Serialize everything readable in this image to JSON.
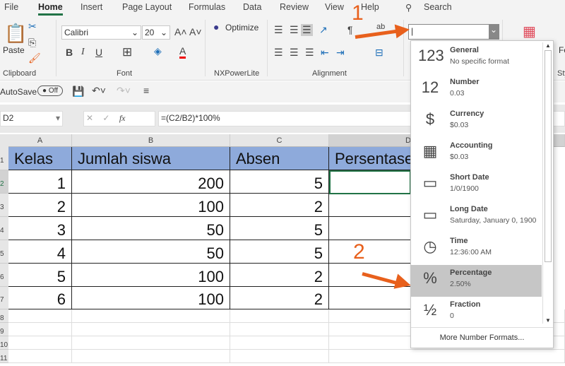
{
  "menu": [
    "File",
    "Home",
    "Insert",
    "Page Layout",
    "Formulas",
    "Data",
    "Review",
    "View",
    "Help"
  ],
  "search": "Search",
  "ribbon": {
    "paste": "Paste",
    "font_name": "Calibri",
    "font_size": "20",
    "optimize": "Optimize",
    "groups": {
      "clipboard": "Clipboard",
      "font": "Font",
      "nx": "NXPowerLite",
      "alignment": "Alignment",
      "styles": "Sty"
    },
    "fo": "Fo",
    "bold": "B",
    "italic": "I",
    "underline": "U",
    "font_color": "A"
  },
  "qat": {
    "autosave": "AutoSave",
    "toggle": "Off"
  },
  "formula": {
    "name_box": "D2",
    "fx": "fx",
    "value": "=(C2/B2)*100%"
  },
  "columns": [
    "A",
    "B",
    "C",
    "D"
  ],
  "rows": [
    "1",
    "2",
    "3",
    "4",
    "5",
    "6",
    "7",
    "8",
    "9",
    "10",
    "11"
  ],
  "table": {
    "headers": [
      "Kelas",
      "Jumlah siswa",
      "Absen",
      "Persentase"
    ],
    "data": [
      [
        "1",
        "200",
        "5"
      ],
      [
        "2",
        "100",
        "2"
      ],
      [
        "3",
        "50",
        "5"
      ],
      [
        "4",
        "50",
        "5"
      ],
      [
        "5",
        "100",
        "2"
      ],
      [
        "6",
        "100",
        "2"
      ]
    ]
  },
  "number_format": {
    "value": "",
    "items": [
      {
        "icon": "123",
        "title": "General",
        "sub": "No specific format"
      },
      {
        "icon": "12",
        "title": "Number",
        "sub": "0.03"
      },
      {
        "icon": "$",
        "title": "Currency",
        "sub": "$0.03"
      },
      {
        "icon": "▦",
        "title": "Accounting",
        "sub": " $0.03"
      },
      {
        "icon": "▭",
        "title": "Short Date",
        "sub": "1/0/1900"
      },
      {
        "icon": "▭",
        "title": "Long Date",
        "sub": "Saturday, January 0, 1900"
      },
      {
        "icon": "◷",
        "title": "Time",
        "sub": "12:36:00 AM"
      },
      {
        "icon": "%",
        "title": "Percentage",
        "sub": "2.50%"
      },
      {
        "icon": "½",
        "title": "Fraction",
        "sub": "0"
      }
    ],
    "more": "More Number Formats..."
  },
  "annotations": [
    "1",
    "2"
  ],
  "colors": {
    "accent": "#217346",
    "header_fill": "#8eaadb",
    "arrow": "#e8601c"
  }
}
